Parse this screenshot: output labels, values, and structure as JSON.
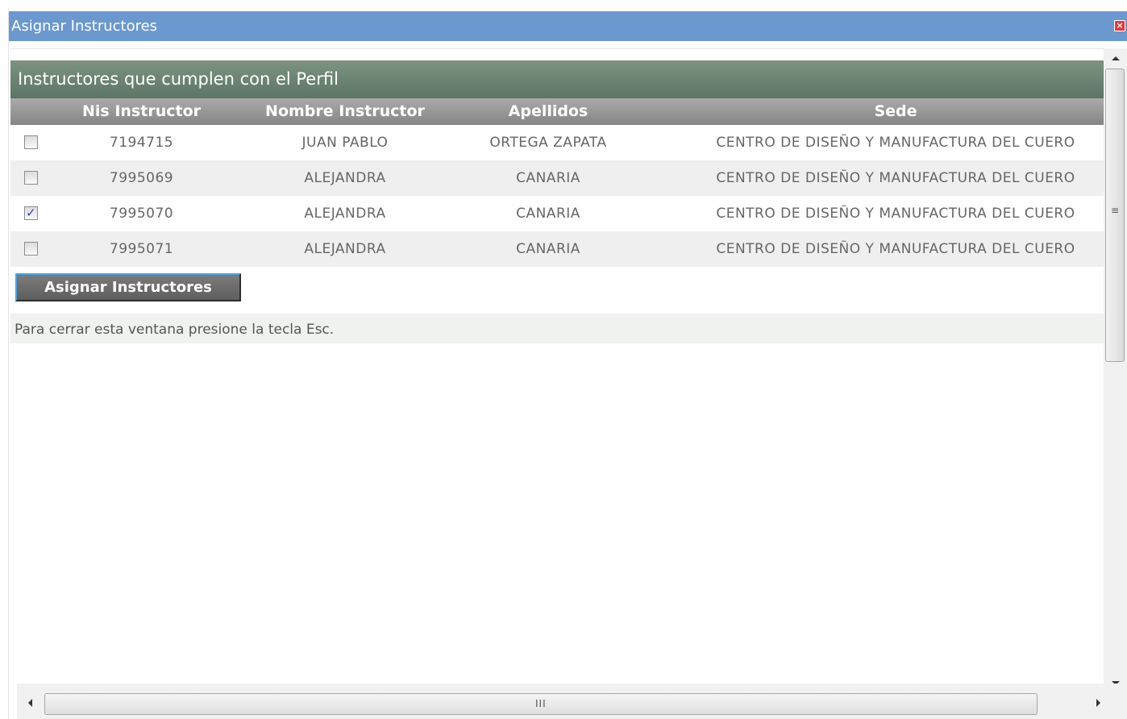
{
  "window": {
    "title": "Asignar Instructores",
    "close_icon": "close-icon"
  },
  "section": {
    "title": "Instructores que cumplen con el Perfil"
  },
  "table": {
    "headers": [
      "",
      "Nis Instructor",
      "Nombre Instructor",
      "Apellidos",
      "Sede"
    ],
    "rows": [
      {
        "checked": false,
        "nis": "7194715",
        "nombre": "JUAN PABLO",
        "apellidos": "ORTEGA ZAPATA",
        "sede": "CENTRO DE DISEÑO Y MANUFACTURA DEL CUERO"
      },
      {
        "checked": false,
        "nis": "7995069",
        "nombre": "ALEJANDRA",
        "apellidos": "CANARIA",
        "sede": "CENTRO DE DISEÑO Y MANUFACTURA DEL CUERO"
      },
      {
        "checked": true,
        "nis": "7995070",
        "nombre": "ALEJANDRA",
        "apellidos": "CANARIA",
        "sede": "CENTRO DE DISEÑO Y MANUFACTURA DEL CUERO"
      },
      {
        "checked": false,
        "nis": "7995071",
        "nombre": "ALEJANDRA",
        "apellidos": "CANARIA",
        "sede": "CENTRO DE DISEÑO Y MANUFACTURA DEL CUERO"
      }
    ]
  },
  "actions": {
    "assign_label": "Asignar Instructores"
  },
  "footer": {
    "note": "Para cerrar esta ventana presione la tecla Esc."
  },
  "colors": {
    "titlebar": "#6a98cf",
    "section_header": "#6b8470",
    "column_header": "#979797",
    "alt_row": "#efefef"
  }
}
